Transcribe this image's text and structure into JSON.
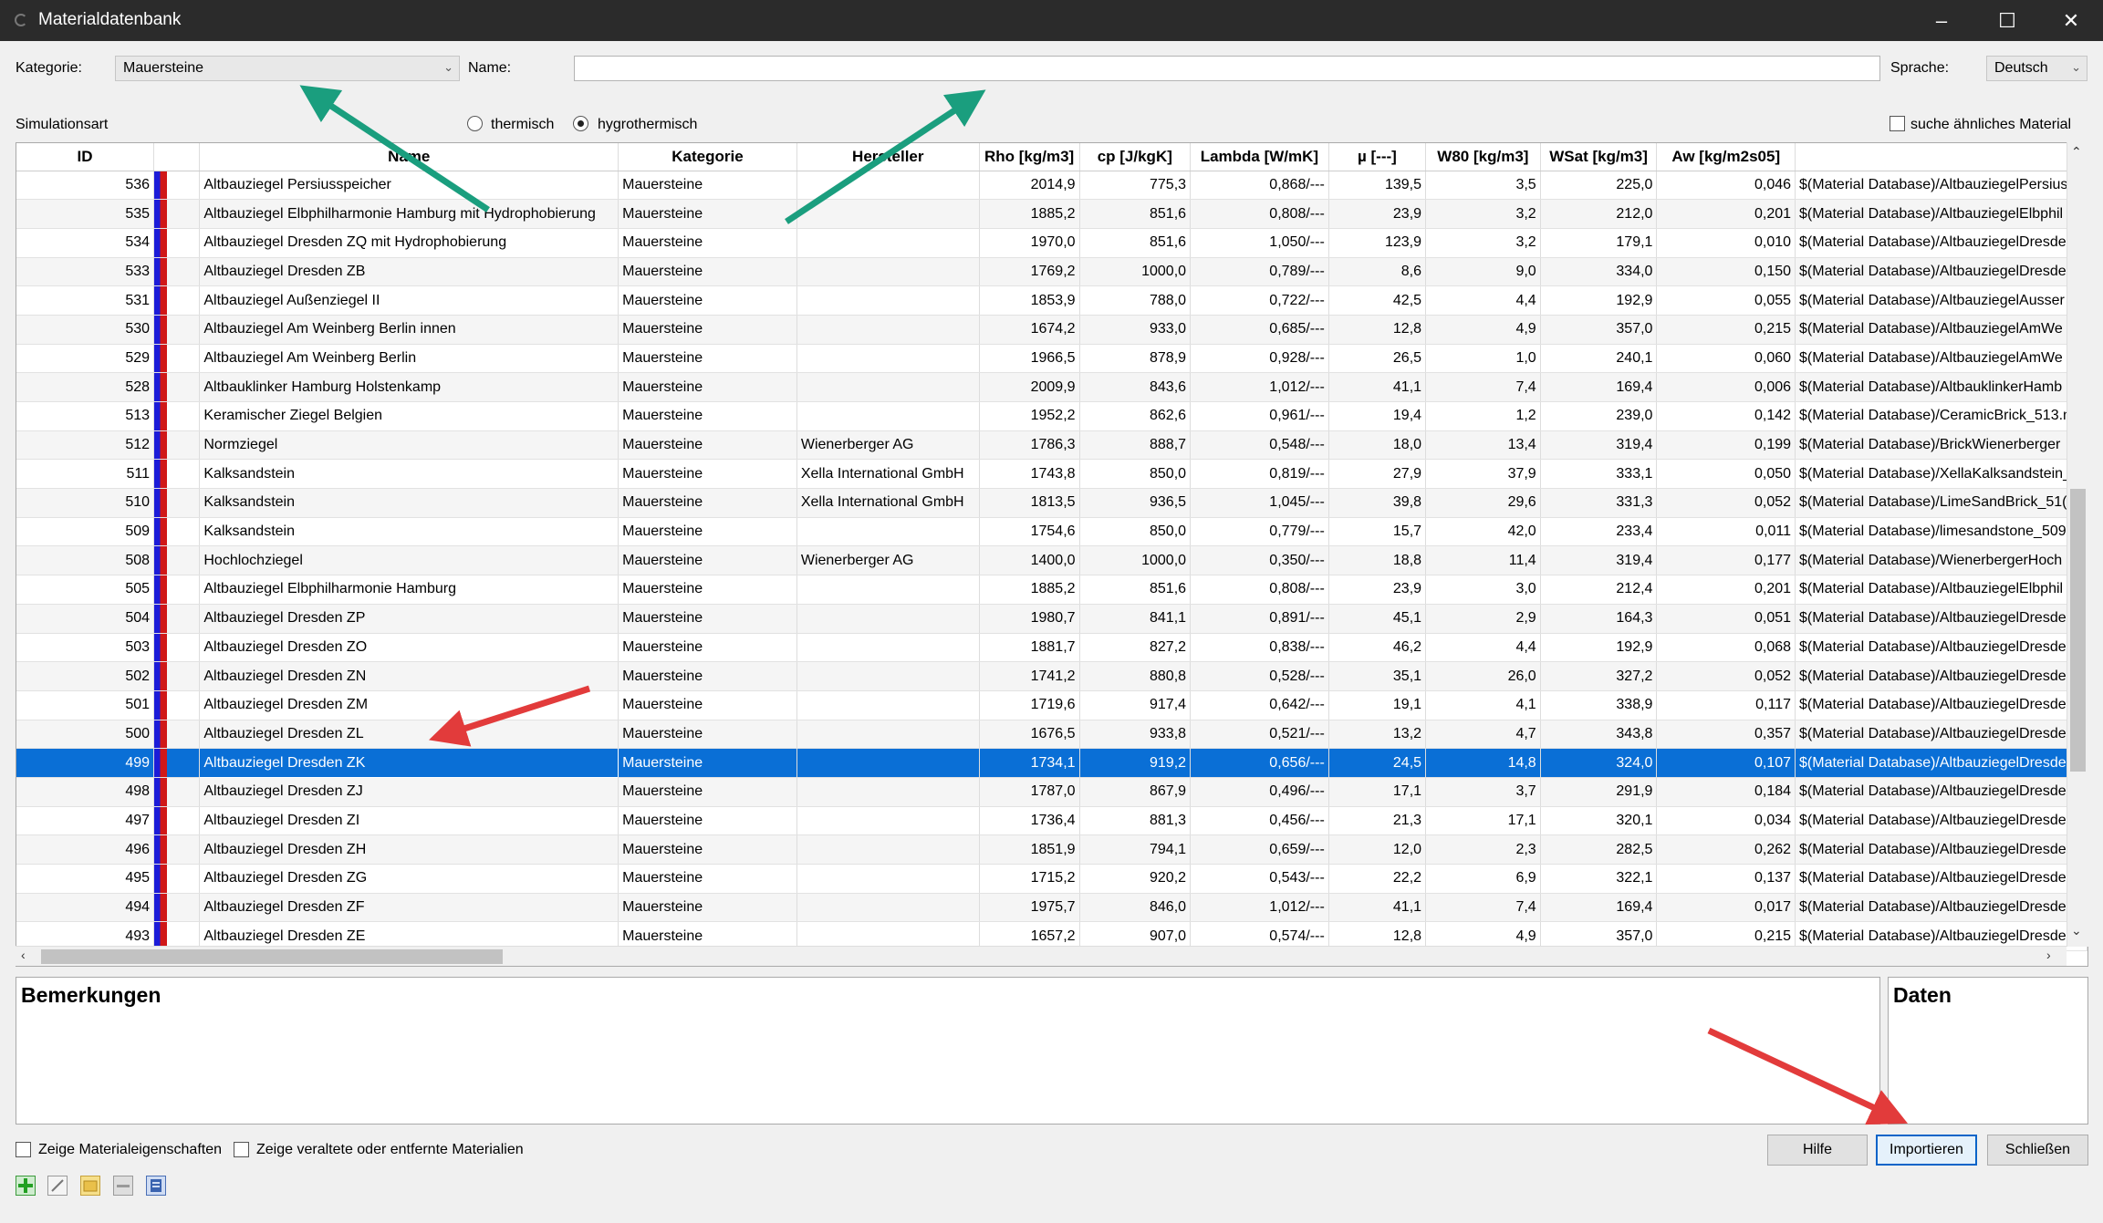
{
  "window": {
    "title": "Materialdatenbank"
  },
  "filters": {
    "kategorie_label": "Kategorie:",
    "kategorie_value": "Mauersteine",
    "name_label": "Name:",
    "name_value": "",
    "sprache_label": "Sprache:",
    "sprache_value": "Deutsch",
    "simulationsart_label": "Simulationsart",
    "radio_thermisch": "thermisch",
    "radio_hygrothermisch": "hygrothermisch",
    "selected_simulationsart": "hygrothermisch",
    "suche_aehnliches": "suche ähnliches Material"
  },
  "table": {
    "columns": [
      "ID",
      "",
      "Name",
      "Kategorie",
      "Hersteller",
      "Rho [kg/m3]",
      "cp [J/kgK]",
      "Lambda [W/mK]",
      "µ [---]",
      "W80 [kg/m3]",
      "WSat [kg/m3]",
      "Aw [kg/m2s05]",
      ""
    ],
    "selected_id": "499",
    "rows": [
      {
        "id": "536",
        "name": "Altbauziegel Persiusspeicher",
        "kategorie": "Mauersteine",
        "hersteller": "",
        "rho": "2014,9",
        "cp": "775,3",
        "lambda": "0,868/---",
        "mu": "139,5",
        "w80": "3,5",
        "wsat": "225,0",
        "aw": "0,046",
        "path": "$(Material Database)/AltbauziegelPersius"
      },
      {
        "id": "535",
        "name": "Altbauziegel Elbphilharmonie Hamburg mit Hydrophobierung",
        "kategorie": "Mauersteine",
        "hersteller": "",
        "rho": "1885,2",
        "cp": "851,6",
        "lambda": "0,808/---",
        "mu": "23,9",
        "w80": "3,2",
        "wsat": "212,0",
        "aw": "0,201",
        "path": "$(Material Database)/AltbauziegelElbphil"
      },
      {
        "id": "534",
        "name": "Altbauziegel Dresden ZQ mit Hydrophobierung",
        "kategorie": "Mauersteine",
        "hersteller": "",
        "rho": "1970,0",
        "cp": "851,6",
        "lambda": "1,050/---",
        "mu": "123,9",
        "w80": "3,2",
        "wsat": "179,1",
        "aw": "0,010",
        "path": "$(Material Database)/AltbauziegelDresde"
      },
      {
        "id": "533",
        "name": "Altbauziegel Dresden ZB",
        "kategorie": "Mauersteine",
        "hersteller": "",
        "rho": "1769,2",
        "cp": "1000,0",
        "lambda": "0,789/---",
        "mu": "8,6",
        "w80": "9,0",
        "wsat": "334,0",
        "aw": "0,150",
        "path": "$(Material Database)/AltbauziegelDresde"
      },
      {
        "id": "531",
        "name": "Altbauziegel Außenziegel II",
        "kategorie": "Mauersteine",
        "hersteller": "",
        "rho": "1853,9",
        "cp": "788,0",
        "lambda": "0,722/---",
        "mu": "42,5",
        "w80": "4,4",
        "wsat": "192,9",
        "aw": "0,055",
        "path": "$(Material Database)/AltbauziegelAusser"
      },
      {
        "id": "530",
        "name": "Altbauziegel Am Weinberg Berlin innen",
        "kategorie": "Mauersteine",
        "hersteller": "",
        "rho": "1674,2",
        "cp": "933,0",
        "lambda": "0,685/---",
        "mu": "12,8",
        "w80": "4,9",
        "wsat": "357,0",
        "aw": "0,215",
        "path": "$(Material Database)/AltbauziegelAmWe"
      },
      {
        "id": "529",
        "name": "Altbauziegel Am Weinberg Berlin",
        "kategorie": "Mauersteine",
        "hersteller": "",
        "rho": "1966,5",
        "cp": "878,9",
        "lambda": "0,928/---",
        "mu": "26,5",
        "w80": "1,0",
        "wsat": "240,1",
        "aw": "0,060",
        "path": "$(Material Database)/AltbauziegelAmWe"
      },
      {
        "id": "528",
        "name": "Altbauklinker Hamburg Holstenkamp",
        "kategorie": "Mauersteine",
        "hersteller": "",
        "rho": "2009,9",
        "cp": "843,6",
        "lambda": "1,012/---",
        "mu": "41,1",
        "w80": "7,4",
        "wsat": "169,4",
        "aw": "0,006",
        "path": "$(Material Database)/AltbauklinkerHamb"
      },
      {
        "id": "513",
        "name": "Keramischer Ziegel Belgien",
        "kategorie": "Mauersteine",
        "hersteller": "",
        "rho": "1952,2",
        "cp": "862,6",
        "lambda": "0,961/---",
        "mu": "19,4",
        "w80": "1,2",
        "wsat": "239,0",
        "aw": "0,142",
        "path": "$(Material Database)/CeramicBrick_513.m"
      },
      {
        "id": "512",
        "name": "Normziegel",
        "kategorie": "Mauersteine",
        "hersteller": "Wienerberger AG",
        "rho": "1786,3",
        "cp": "888,7",
        "lambda": "0,548/---",
        "mu": "18,0",
        "w80": "13,4",
        "wsat": "319,4",
        "aw": "0,199",
        "path": "$(Material Database)/BrickWienerberger"
      },
      {
        "id": "511",
        "name": "Kalksandstein",
        "kategorie": "Mauersteine",
        "hersteller": "Xella International GmbH",
        "rho": "1743,8",
        "cp": "850,0",
        "lambda": "0,819/---",
        "mu": "27,9",
        "w80": "37,9",
        "wsat": "333,1",
        "aw": "0,050",
        "path": "$(Material Database)/XellaKalksandstein_"
      },
      {
        "id": "510",
        "name": "Kalksandstein",
        "kategorie": "Mauersteine",
        "hersteller": "Xella International GmbH",
        "rho": "1813,5",
        "cp": "936,5",
        "lambda": "1,045/---",
        "mu": "39,8",
        "w80": "29,6",
        "wsat": "331,3",
        "aw": "0,052",
        "path": "$(Material Database)/LimeSandBrick_51("
      },
      {
        "id": "509",
        "name": "Kalksandstein",
        "kategorie": "Mauersteine",
        "hersteller": "",
        "rho": "1754,6",
        "cp": "850,0",
        "lambda": "0,779/---",
        "mu": "15,7",
        "w80": "42,0",
        "wsat": "233,4",
        "aw": "0,011",
        "path": "$(Material Database)/limesandstone_509"
      },
      {
        "id": "508",
        "name": "Hochlochziegel",
        "kategorie": "Mauersteine",
        "hersteller": "Wienerberger AG",
        "rho": "1400,0",
        "cp": "1000,0",
        "lambda": "0,350/---",
        "mu": "18,8",
        "w80": "11,4",
        "wsat": "319,4",
        "aw": "0,177",
        "path": "$(Material Database)/WienerbergerHoch"
      },
      {
        "id": "505",
        "name": "Altbauziegel Elbphilharmonie Hamburg",
        "kategorie": "Mauersteine",
        "hersteller": "",
        "rho": "1885,2",
        "cp": "851,6",
        "lambda": "0,808/---",
        "mu": "23,9",
        "w80": "3,0",
        "wsat": "212,4",
        "aw": "0,201",
        "path": "$(Material Database)/AltbauziegelElbphil"
      },
      {
        "id": "504",
        "name": "Altbauziegel Dresden ZP",
        "kategorie": "Mauersteine",
        "hersteller": "",
        "rho": "1980,7",
        "cp": "841,1",
        "lambda": "0,891/---",
        "mu": "45,1",
        "w80": "2,9",
        "wsat": "164,3",
        "aw": "0,051",
        "path": "$(Material Database)/AltbauziegelDresde"
      },
      {
        "id": "503",
        "name": "Altbauziegel Dresden ZO",
        "kategorie": "Mauersteine",
        "hersteller": "",
        "rho": "1881,7",
        "cp": "827,2",
        "lambda": "0,838/---",
        "mu": "46,2",
        "w80": "4,4",
        "wsat": "192,9",
        "aw": "0,068",
        "path": "$(Material Database)/AltbauziegelDresde"
      },
      {
        "id": "502",
        "name": "Altbauziegel Dresden ZN",
        "kategorie": "Mauersteine",
        "hersteller": "",
        "rho": "1741,2",
        "cp": "880,8",
        "lambda": "0,528/---",
        "mu": "35,1",
        "w80": "26,0",
        "wsat": "327,2",
        "aw": "0,052",
        "path": "$(Material Database)/AltbauziegelDresde"
      },
      {
        "id": "501",
        "name": "Altbauziegel Dresden ZM",
        "kategorie": "Mauersteine",
        "hersteller": "",
        "rho": "1719,6",
        "cp": "917,4",
        "lambda": "0,642/---",
        "mu": "19,1",
        "w80": "4,1",
        "wsat": "338,9",
        "aw": "0,117",
        "path": "$(Material Database)/AltbauziegelDresde"
      },
      {
        "id": "500",
        "name": "Altbauziegel Dresden ZL",
        "kategorie": "Mauersteine",
        "hersteller": "",
        "rho": "1676,5",
        "cp": "933,8",
        "lambda": "0,521/---",
        "mu": "13,2",
        "w80": "4,7",
        "wsat": "343,8",
        "aw": "0,357",
        "path": "$(Material Database)/AltbauziegelDresde"
      },
      {
        "id": "499",
        "name": "Altbauziegel Dresden ZK",
        "kategorie": "Mauersteine",
        "hersteller": "",
        "rho": "1734,1",
        "cp": "919,2",
        "lambda": "0,656/---",
        "mu": "24,5",
        "w80": "14,8",
        "wsat": "324,0",
        "aw": "0,107",
        "path": "$(Material Database)/AltbauziegelDresde"
      },
      {
        "id": "498",
        "name": "Altbauziegel Dresden ZJ",
        "kategorie": "Mauersteine",
        "hersteller": "",
        "rho": "1787,0",
        "cp": "867,9",
        "lambda": "0,496/---",
        "mu": "17,1",
        "w80": "3,7",
        "wsat": "291,9",
        "aw": "0,184",
        "path": "$(Material Database)/AltbauziegelDresde"
      },
      {
        "id": "497",
        "name": "Altbauziegel Dresden ZI",
        "kategorie": "Mauersteine",
        "hersteller": "",
        "rho": "1736,4",
        "cp": "881,3",
        "lambda": "0,456/---",
        "mu": "21,3",
        "w80": "17,1",
        "wsat": "320,1",
        "aw": "0,034",
        "path": "$(Material Database)/AltbauziegelDresde"
      },
      {
        "id": "496",
        "name": "Altbauziegel Dresden ZH",
        "kategorie": "Mauersteine",
        "hersteller": "",
        "rho": "1851,9",
        "cp": "794,1",
        "lambda": "0,659/---",
        "mu": "12,0",
        "w80": "2,3",
        "wsat": "282,5",
        "aw": "0,262",
        "path": "$(Material Database)/AltbauziegelDresde"
      },
      {
        "id": "495",
        "name": "Altbauziegel Dresden ZG",
        "kategorie": "Mauersteine",
        "hersteller": "",
        "rho": "1715,2",
        "cp": "920,2",
        "lambda": "0,543/---",
        "mu": "22,2",
        "w80": "6,9",
        "wsat": "322,1",
        "aw": "0,137",
        "path": "$(Material Database)/AltbauziegelDresde"
      },
      {
        "id": "494",
        "name": "Altbauziegel Dresden ZF",
        "kategorie": "Mauersteine",
        "hersteller": "",
        "rho": "1975,7",
        "cp": "846,0",
        "lambda": "1,012/---",
        "mu": "41,1",
        "w80": "7,4",
        "wsat": "169,4",
        "aw": "0,017",
        "path": "$(Material Database)/AltbauziegelDresde"
      },
      {
        "id": "493",
        "name": "Altbauziegel Dresden ZE",
        "kategorie": "Mauersteine",
        "hersteller": "",
        "rho": "1657,2",
        "cp": "907,0",
        "lambda": "0,574/---",
        "mu": "12,8",
        "w80": "4,9",
        "wsat": "357,0",
        "aw": "0,215",
        "path": "$(Material Database)/AltbauziegelDresde"
      }
    ]
  },
  "panels": {
    "bemerkungen": "Bemerkungen",
    "daten": "Daten"
  },
  "footer": {
    "zeige_materialeigenschaften": "Zeige Materialeigenschaften",
    "zeige_veraltete": "Zeige veraltete oder entfernte Materialien",
    "hilfe": "Hilfe",
    "importieren": "Importieren",
    "schliessen": "Schließen"
  },
  "toolbar_icons": [
    "add-icon",
    "edit-icon",
    "folder-icon",
    "remove-icon",
    "database-icon"
  ],
  "colors": {
    "selection": "#0a6fd6",
    "annotation_green": "#1a9e7e",
    "annotation_red": "#e23b3b"
  }
}
